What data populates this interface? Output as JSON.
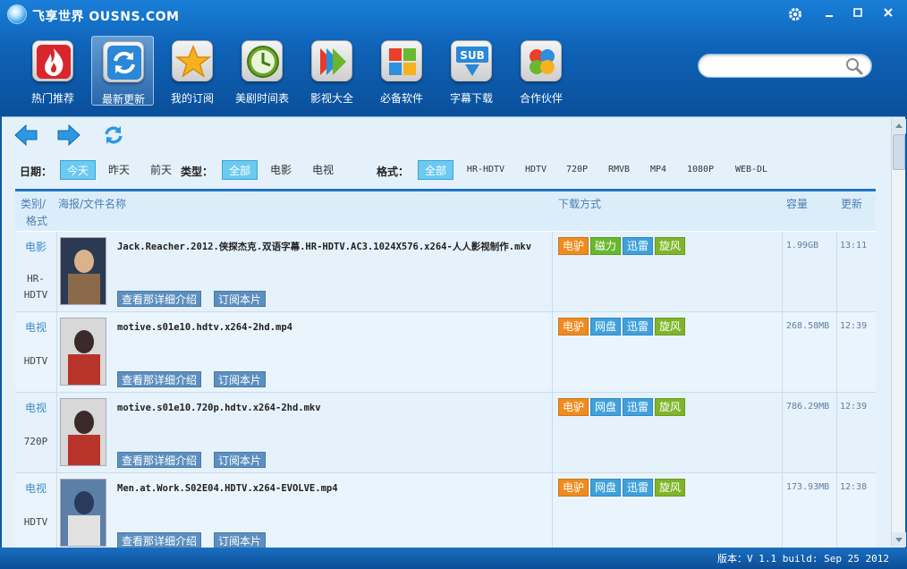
{
  "app": {
    "title": "飞享世界 OUSNS.COM"
  },
  "toolbar": {
    "items": [
      {
        "label": "热门推荐",
        "icon": "flame-icon"
      },
      {
        "label": "最新更新",
        "icon": "refresh-icon"
      },
      {
        "label": "我的订阅",
        "icon": "star-icon"
      },
      {
        "label": "美剧时间表",
        "icon": "clock-icon"
      },
      {
        "label": "影视大全",
        "icon": "play-icon"
      },
      {
        "label": "必备软件",
        "icon": "windows-icon"
      },
      {
        "label": "字幕下载",
        "icon": "subtitle-download-icon"
      },
      {
        "label": "合作伙伴",
        "icon": "partners-icon"
      }
    ],
    "active_index": 1,
    "sub_icon_text": "SUB"
  },
  "search": {
    "placeholder": ""
  },
  "filters": {
    "date_label": "日期：",
    "dates": [
      "今天",
      "昨天",
      "前天"
    ],
    "type_label": "类型：",
    "types": [
      "全部",
      "电影",
      "电视"
    ],
    "format_label": "格式：",
    "formats": [
      "全部",
      "HR-HDTV",
      "HDTV",
      "720P",
      "RMVB",
      "MP4",
      "1080P",
      "WEB-DL"
    ]
  },
  "table": {
    "headers": {
      "category": "类别/格式",
      "category_line1": "类别/",
      "category_line2": "格式",
      "name": "海报/文件名称",
      "download": "下载方式",
      "size": "容量",
      "update": "更新"
    },
    "detail_label": "查看那详细介绍",
    "subscribe_label": "订阅本片",
    "rows": [
      {
        "category": "电影",
        "format": "HR-HDTV",
        "filename": "Jack.Reacher.2012.侠探杰克.双语字幕.HR-HDTV.AC3.1024X576.x264-人人影视制作.mkv",
        "downloads": [
          "电驴",
          "磁力",
          "迅雷",
          "旋风"
        ],
        "size": "1.99GB",
        "updated": "13:11"
      },
      {
        "category": "电视",
        "format": "HDTV",
        "filename": "motive.s01e10.hdtv.x264-2hd.mp4",
        "downloads": [
          "电驴",
          "网盘",
          "迅雷",
          "旋风"
        ],
        "size": "268.58MB",
        "updated": "12:39"
      },
      {
        "category": "电视",
        "format": "720P",
        "filename": "motive.s01e10.720p.hdtv.x264-2hd.mkv",
        "downloads": [
          "电驴",
          "网盘",
          "迅雷",
          "旋风"
        ],
        "size": "786.29MB",
        "updated": "12:39"
      },
      {
        "category": "电视",
        "format": "HDTV",
        "filename": "Men.at.Work.S02E04.HDTV.x264-EVOLVE.mp4",
        "downloads": [
          "电驴",
          "网盘",
          "迅雷",
          "旋风"
        ],
        "size": "173.93MB",
        "updated": "12:38"
      }
    ]
  },
  "status": {
    "version": "版本：V 1.1 build: Sep 25 2012"
  },
  "colors": {
    "header_blue": "#0f63b8",
    "accent_cyan": "#6ccaf0",
    "ed2k_orange": "#ef8b1f",
    "magnet_green": "#68b82e",
    "thunder_blue": "#3fa0dc",
    "xuanfeng_lime": "#7fb52a"
  }
}
